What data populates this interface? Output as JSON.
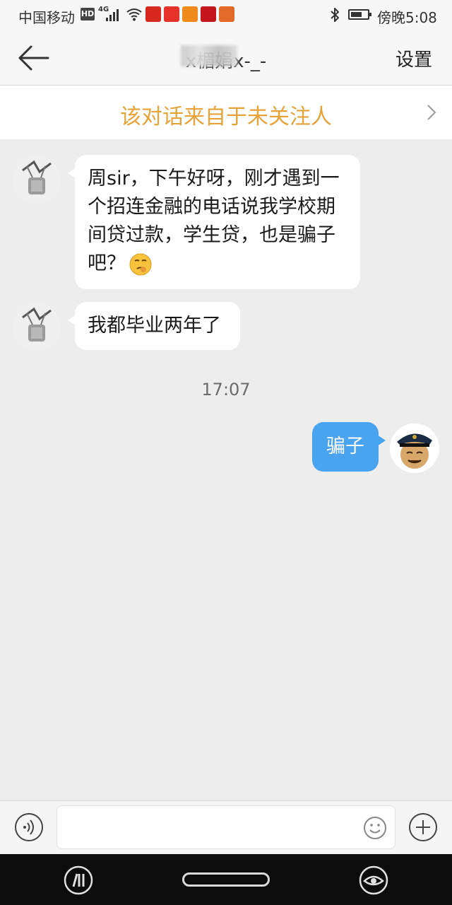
{
  "status_bar": {
    "carrier": "中国移动",
    "hd_badge": "HD",
    "network": "4G",
    "battery_level": 0.7,
    "time": "傍晚5:08"
  },
  "header": {
    "title": "x楣娟x-_-",
    "settings_label": "设置"
  },
  "banner": {
    "text": "该对话来自于未关注人"
  },
  "messages": [
    {
      "side": "left",
      "text": "周sir，下午好呀，刚才遇到一个招连金融的电话说我学校期间贷过款，学生贷，也是骗子吧？"
    },
    {
      "side": "left",
      "text": "我都毕业两年了"
    },
    {
      "side": "right",
      "text": "骗子"
    }
  ],
  "timestamp": "17:07",
  "input": {
    "value": "",
    "placeholder": ""
  },
  "colors": {
    "banner_text": "#e5a33a",
    "sent_bubble": "#4aa3ee",
    "received_bubble": "#ffffff",
    "chat_background": "#ededed"
  }
}
